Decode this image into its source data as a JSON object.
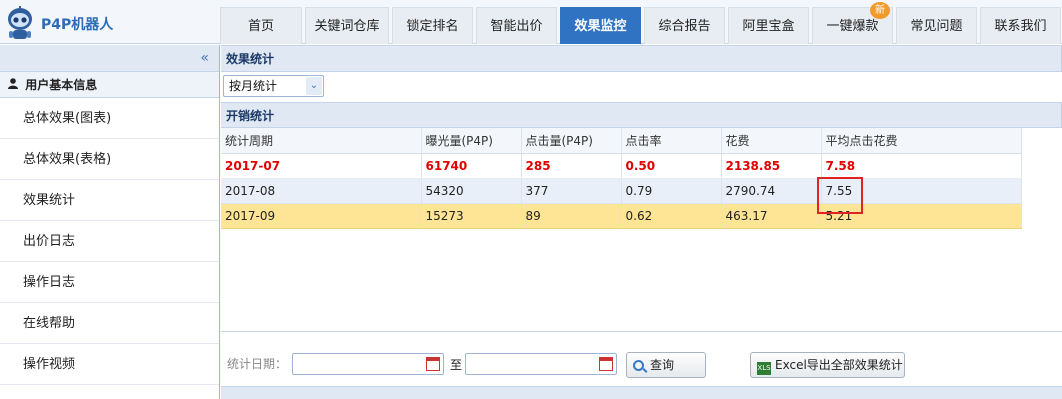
{
  "header": {
    "logo_text": "P4P机器人",
    "nav": [
      {
        "label": "首页",
        "active": false
      },
      {
        "label": "关键词仓库",
        "active": false
      },
      {
        "label": "锁定排名",
        "active": false
      },
      {
        "label": "智能出价",
        "active": false
      },
      {
        "label": "效果监控",
        "active": true
      },
      {
        "label": "综合报告",
        "active": false
      },
      {
        "label": "阿里宝盒",
        "active": false
      },
      {
        "label": "一键爆款",
        "active": false,
        "badge": "新"
      },
      {
        "label": "常见问题",
        "active": false
      },
      {
        "label": "联系我们",
        "active": false
      }
    ]
  },
  "sidebar": {
    "collapse_icon": "«",
    "section_title": "用户基本信息",
    "items": [
      {
        "label": "总体效果(图表)"
      },
      {
        "label": "总体效果(表格)"
      },
      {
        "label": "效果统计"
      },
      {
        "label": "出价日志"
      },
      {
        "label": "操作日志"
      },
      {
        "label": "在线帮助"
      },
      {
        "label": "操作视频"
      }
    ]
  },
  "main": {
    "panel_title": "效果统计",
    "period_select": {
      "value": "按月统计"
    },
    "table_title": "开销统计",
    "columns": [
      "统计周期",
      "曝光量(P4P)",
      "点击量(P4P)",
      "点击率",
      "花费",
      "平均点击花费"
    ],
    "rows": [
      [
        "2017-07",
        "61740",
        "285",
        "0.50",
        "2138.85",
        "7.58"
      ],
      [
        "2017-08",
        "54320",
        "377",
        "0.79",
        "2790.74",
        "7.55"
      ],
      [
        "2017-09",
        "15273",
        "89",
        "0.62",
        "463.17",
        "5.21"
      ]
    ],
    "filter": {
      "date_label": "统计日期：",
      "to_label": "至",
      "search_label": "查询",
      "export_label": "Excel导出全部效果统计",
      "excel_icon_text": "XLS"
    }
  }
}
